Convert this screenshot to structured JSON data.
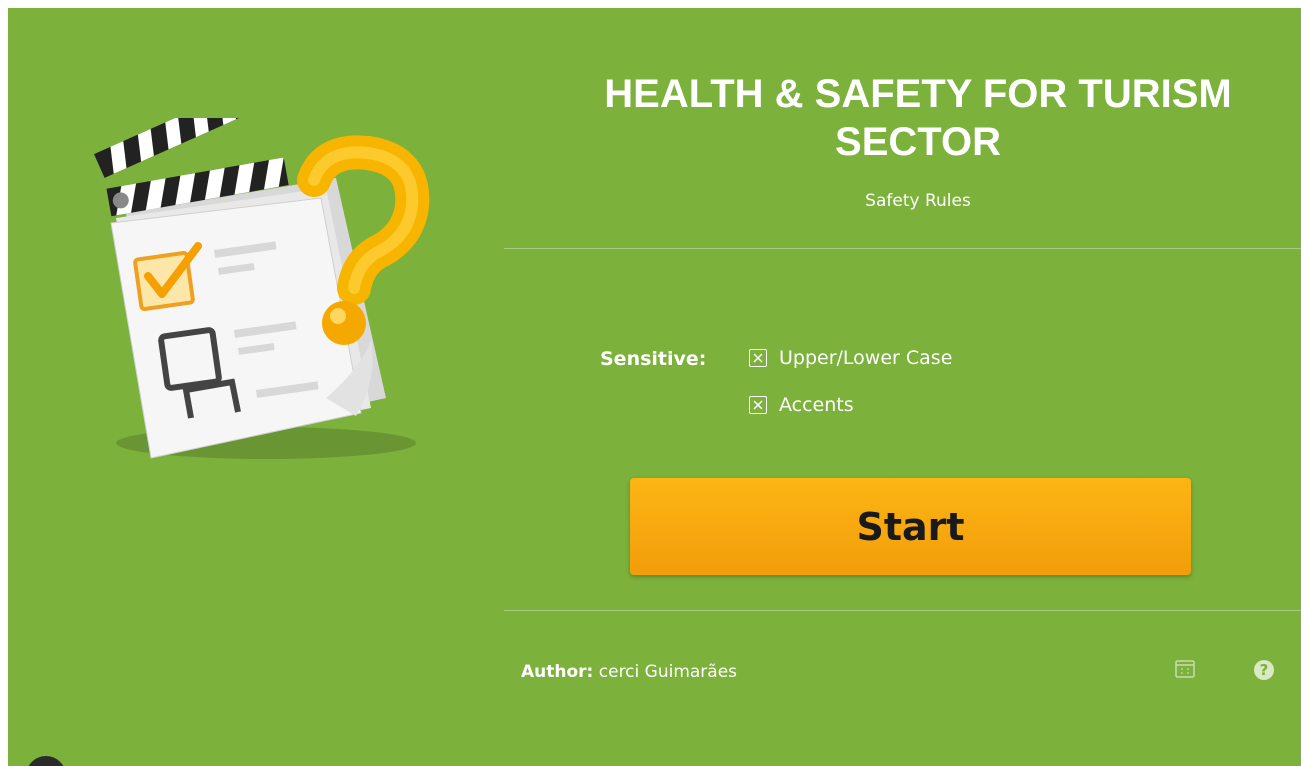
{
  "header": {
    "title": "HEALTH & SAFETY FOR TURISM SECTOR",
    "subtitle": "Safety Rules"
  },
  "options": {
    "label": "Sensitive:",
    "items": [
      {
        "label": "Upper/Lower Case",
        "checked": true
      },
      {
        "label": "Accents",
        "checked": true
      }
    ]
  },
  "start_button": {
    "label": "Start"
  },
  "footer": {
    "author_label": "Author:",
    "author_name": "cerci Guimarães",
    "icons": [
      "fullscreen-icon",
      "help-icon"
    ]
  },
  "illustration": {
    "icon": "quiz-checklist-clapperboard-question-icon"
  },
  "colors": {
    "background": "#7cb13c",
    "button": "#f7a90f",
    "text": "#ffffff"
  }
}
